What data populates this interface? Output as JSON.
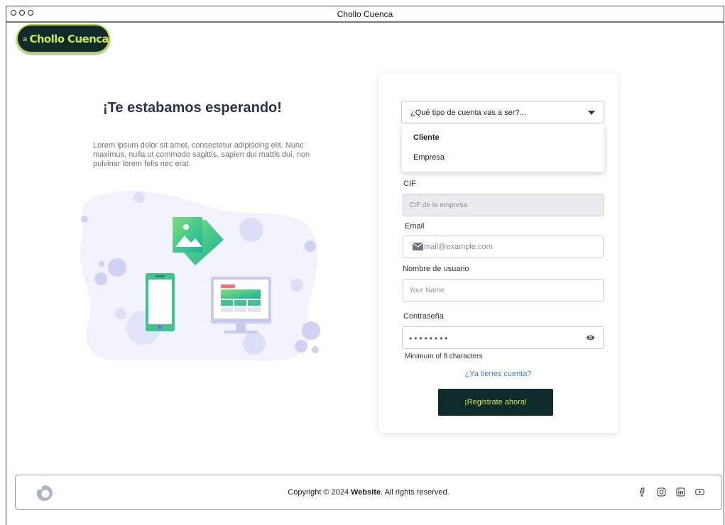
{
  "window": {
    "title": "Chollo Cuenca"
  },
  "logo": {
    "text": "Chollo Cuenca"
  },
  "hero": {
    "title": "¡Te estabamos esperando!",
    "text": "Lorem ipsum dolor sit amet, consectetur adipiscing elit. Nunc maximus, nulla ut commodo sagittis, sapien dui mattis dui, non pulvinar lorem felis nec erat"
  },
  "form": {
    "account_type": {
      "value": "¿Qué tipo de cuenta vas a ser?...",
      "options": [
        "Cliente",
        "Empresa"
      ]
    },
    "cif": {
      "label": "CIF",
      "placeholder": "CIF de la empresa"
    },
    "email": {
      "label": "Email",
      "placeholder": "mail@example.com"
    },
    "username": {
      "label": "Nombre de usuario",
      "placeholder": "Your Name"
    },
    "password": {
      "label": "Contraseña",
      "value": "••••••••",
      "hint": "Minimum of 8 characters"
    },
    "login_link": "¿Ya tienes cuenta?",
    "submit": "¡Registrate ahora!"
  },
  "footer": {
    "copyright_prefix": "Copyright © 2024 ",
    "copyright_brand": "Website",
    "copyright_suffix": ". All rights reserved.",
    "social_icons": [
      "facebook-icon",
      "instagram-icon",
      "linkedin-icon",
      "youtube-icon"
    ]
  },
  "colors": {
    "brand_dark": "#0f2a2a",
    "brand_lime": "#c9e84a",
    "link": "#3b7fd6"
  }
}
